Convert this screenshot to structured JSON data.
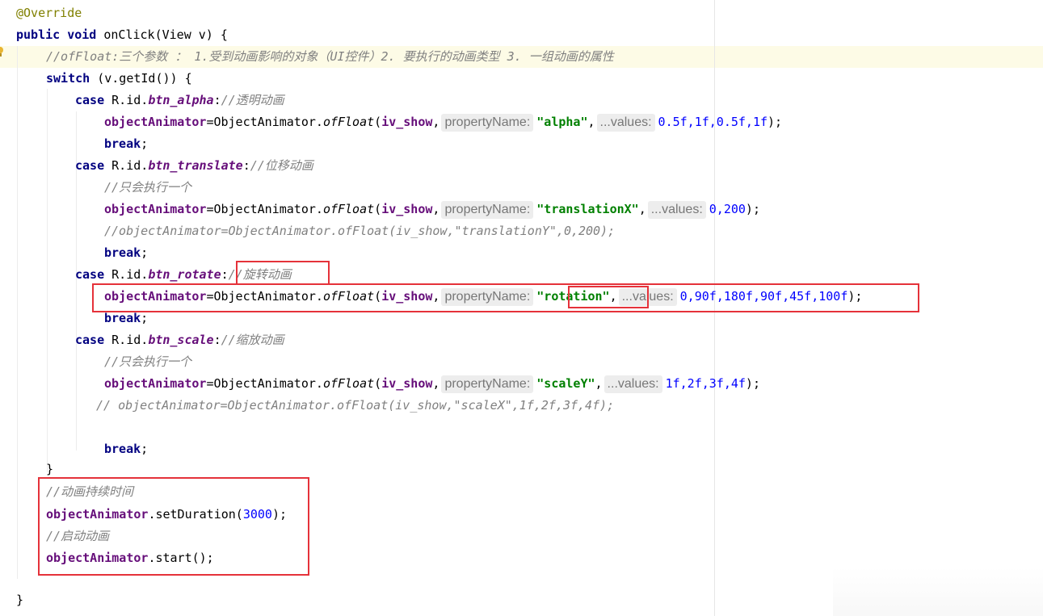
{
  "code": {
    "l1": {
      "annotation": "@Override"
    },
    "l2": {
      "kw": "public void",
      "text": " onClick(View v) {"
    },
    "l3": {
      "comment": "//ofFloat:三个参数 ： 1.受到动画影响的对象（UI控件）2. 要执行的动画类型 3. 一组动画的属性"
    },
    "l4": {
      "kw": "switch",
      "text": " (v.getId()) {"
    },
    "l5": {
      "kw": "case",
      "pre": " R.id.",
      "id": "btn_alpha",
      "colon": ":",
      "comment": "//透明动画"
    },
    "l6": {
      "field": "objectAnimator",
      "mid": "=ObjectAnimator.",
      "method": "ofFloat",
      "open": "(",
      "arg1": "iv_show",
      "comma1": ",",
      "hint1": "propertyName:",
      "str": "\"alpha\"",
      "comma2": ",",
      "hint2": "...values:",
      "values": "0.5f,1f,0.5f,1f",
      "close": ");"
    },
    "l7": {
      "kw": "break",
      "semi": ";"
    },
    "l8": {
      "kw": "case",
      "pre": " R.id.",
      "id": "btn_translate",
      "colon": ":",
      "comment": "//位移动画"
    },
    "l9": {
      "comment": "//只会执行一个"
    },
    "l10": {
      "field": "objectAnimator",
      "mid": "=ObjectAnimator.",
      "method": "ofFloat",
      "open": "(",
      "arg1": "iv_show",
      "comma1": ",",
      "hint1": "propertyName:",
      "str": "\"translationX\"",
      "comma2": ",",
      "hint2": "...values:",
      "values": "0,200",
      "close": ");"
    },
    "l11": {
      "comment": "//objectAnimator=ObjectAnimator.ofFloat(iv_show,\"translationY\",0,200);"
    },
    "l12": {
      "kw": "break",
      "semi": ";"
    },
    "l13": {
      "kw": "case",
      "pre": " R.id.",
      "id": "btn_rotate",
      "colon": ":",
      "comment": "//旋转动画"
    },
    "l14": {
      "field": "objectAnimator",
      "mid": "=ObjectAnimator.",
      "method": "ofFloat",
      "open": "(",
      "arg1": "iv_show",
      "comma1": ",",
      "hint1": "propertyName:",
      "str": "\"rotation\"",
      "comma2": ",",
      "hint2": "...values:",
      "values": "0,90f,180f,90f,45f,100f",
      "close": ");"
    },
    "l15": {
      "kw": "break",
      "semi": ";"
    },
    "l16": {
      "kw": "case",
      "pre": " R.id.",
      "id": "btn_scale",
      "colon": ":",
      "comment": "//缩放动画"
    },
    "l17": {
      "comment": "//只会执行一个"
    },
    "l18": {
      "field": "objectAnimator",
      "mid": "=ObjectAnimator.",
      "method": "ofFloat",
      "open": "(",
      "arg1": "iv_show",
      "comma1": ",",
      "hint1": "propertyName:",
      "str": "\"scaleY\"",
      "comma2": ",",
      "hint2": "...values:",
      "values": "1f,2f,3f,4f",
      "close": ");"
    },
    "l19": {
      "comment": "// objectAnimator=ObjectAnimator.ofFloat(iv_show,\"scaleX\",1f,2f,3f,4f);"
    },
    "l20": {
      "kw": "break",
      "semi": ";"
    },
    "l21": {
      "text": "}"
    },
    "l22": {
      "comment": "//动画持续时间"
    },
    "l23": {
      "field": "objectAnimator",
      "mid": ".setDuration(",
      "num": "3000",
      "close": ");"
    },
    "l24": {
      "comment": "//启动动画"
    },
    "l25": {
      "field": "objectAnimator",
      "mid": ".start();"
    },
    "l26": {
      "text": "}"
    }
  },
  "colors": {
    "keyword": "#000080",
    "field": "#660e7a",
    "string": "#008000",
    "number": "#0000ff",
    "comment": "#808080",
    "annotation": "#808000",
    "highlight_box": "#e5323a"
  },
  "icons": {
    "gutter": "lightbulb-icon"
  }
}
